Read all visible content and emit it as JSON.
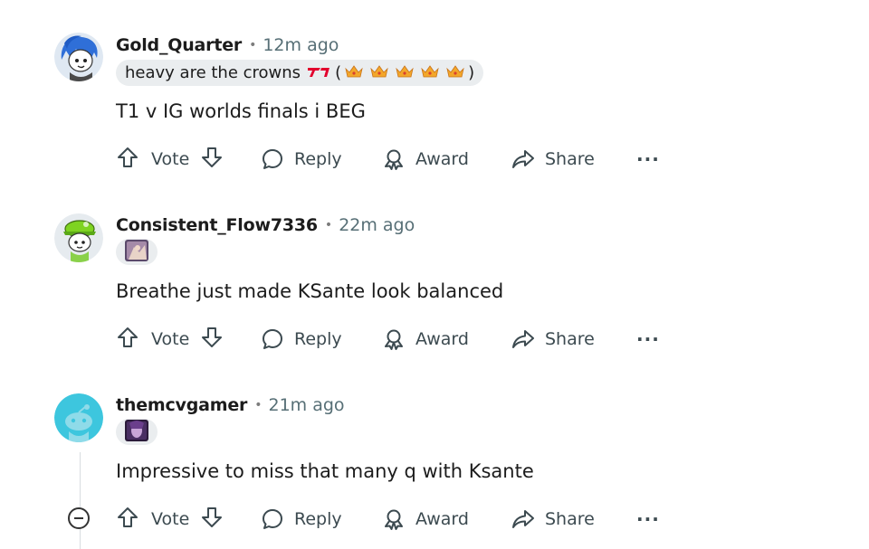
{
  "actions": {
    "vote": "Vote",
    "reply": "Reply",
    "award": "Award",
    "share": "Share",
    "more": "···"
  },
  "comments": [
    {
      "username": "Gold_Quarter",
      "timestamp": "12m ago",
      "flair": "heavy are the crowns",
      "flair_open": "(",
      "flair_close": ")",
      "flair_icons": [
        "t1-logo-icon",
        "crown-icon",
        "crown-icon",
        "crown-icon",
        "crown-icon",
        "crown-icon"
      ],
      "body": "T1 v IG worlds finals i BEG",
      "avatar": "blue-haired-snoo-avatar"
    },
    {
      "username": "Consistent_Flow7336",
      "timestamp": "22m ago",
      "flair_icons": [
        "champion-portrait-icon"
      ],
      "body": "Breathe just made KSante look balanced",
      "avatar": "green-hat-snoo-avatar"
    },
    {
      "username": "themcvgamer",
      "timestamp": "21m ago",
      "flair_icons": [
        "champion-portrait-icon"
      ],
      "body": "Impressive to miss that many q with Ksante",
      "avatar": "default-snoo-avatar"
    }
  ],
  "colors": {
    "flair_bg": "#eaedef",
    "t1_red": "#e2012d",
    "crown_gold": "#f3a72a",
    "default_avatar_bg": "#3dc6de",
    "meta_text": "#576f76"
  }
}
